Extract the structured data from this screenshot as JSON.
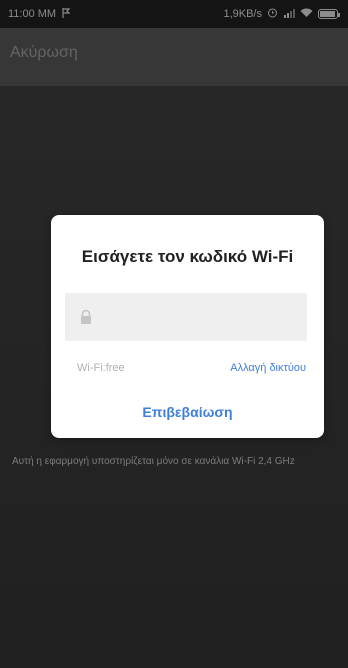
{
  "status_bar": {
    "time": "11:00 MM",
    "network_speed": "1,9KB/s",
    "battery_level_percent": 95
  },
  "header": {
    "cancel_label": "Ακύρωση"
  },
  "background_hint": "Αυτή η εφαρμογή υποστηρίζεται μόνο σε κανάλια Wi-Fi 2,4 GHz",
  "dialog": {
    "title": "Εισάγετε τον κωδικό Wi-Fi",
    "password_value": "",
    "wifi_name": "Wi-Fi:free",
    "change_network_label": "Αλλαγή δικτύου",
    "confirm_label": "Επιβεβαίωση"
  },
  "colors": {
    "accent": "#3f7fdc"
  },
  "icons": {
    "lock": "lock-icon",
    "wifi": "wifi-icon",
    "signal": "signal-icon",
    "battery": "battery-icon",
    "flag": "flag-icon",
    "alarm": "alarm-icon"
  }
}
